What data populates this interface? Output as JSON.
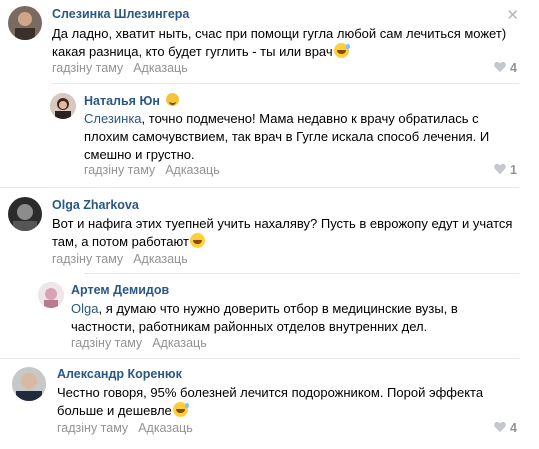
{
  "ui": {
    "accent": "#2a5885",
    "meta_color": "#939393",
    "close_symbol": "✕"
  },
  "comments": [
    {
      "author": "Слезинка Шлезингера",
      "text": "Да ладно, хватит ныть, счас при помощи гугла любой сам лечиться может) какая разница, кто будет гуглить - ты или врач",
      "emoji": "crying-laughing-emoji",
      "time": "гадзіну таму",
      "reply_label": "Адказаць",
      "likes": "4"
    },
    {
      "author": "Наталья Юн",
      "mention": "Слезинка",
      "text": ", точно подмечено! Мама недавно к врачу обратилась с плохим самочувствием, так врач в Гугле искала способ лечения. И смешно и грустно.",
      "time": "гадзіну таму",
      "reply_label": "Адказаць",
      "likes": "1"
    },
    {
      "author": "Olga Zharkova",
      "text": "Вот и нафига этих туепней учить нахаляву? Пусть в еврожопу едут и учатся там, а потом работают",
      "emoji": "grinning-emoji",
      "time": "гадзіну таму",
      "reply_label": "Адказаць"
    },
    {
      "author": "Артем Демидов",
      "mention": "Olga",
      "text": ", я думаю что нужно доверить отбор в медицинские вузы, в частности, работникам районных отделов внутренних дел.",
      "time": "гадзіну таму",
      "reply_label": "Адказаць"
    },
    {
      "author": "Александр Коренюк",
      "text": "Честно говоря, 95% болезней лечится подорожником. Порой эффекта больше и дешевле",
      "emoji": "crying-laughing-emoji",
      "time": "гадзіну таму",
      "reply_label": "Адказаць",
      "likes": "4"
    }
  ]
}
